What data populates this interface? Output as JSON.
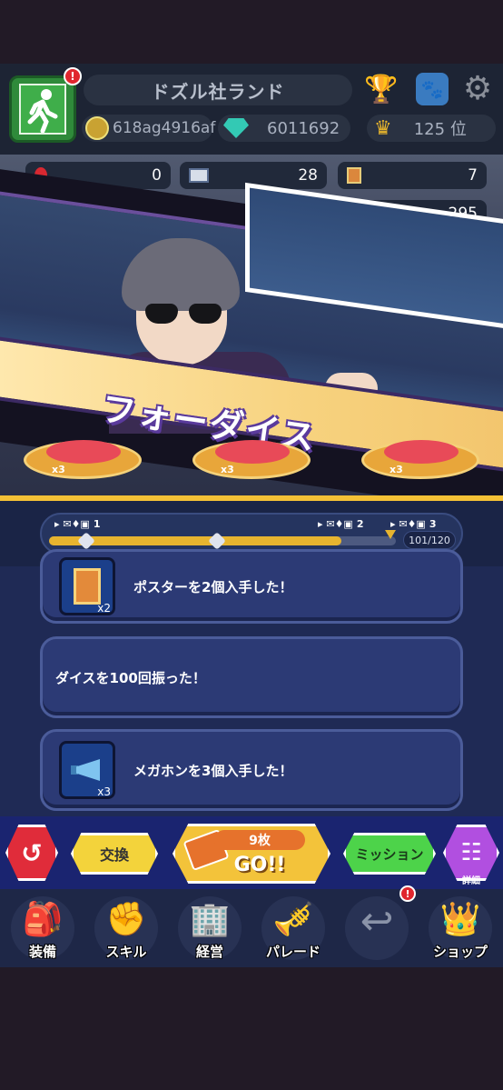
{
  "header": {
    "land_name": "ドズル社ランド",
    "coins": "618ag4916af",
    "gems": "6011692",
    "rank": "125 位",
    "exit_alert": "!"
  },
  "counters": {
    "balloon": "0",
    "ticket": "28",
    "poster": "7",
    "extra": "295"
  },
  "cutscene": {
    "name": "フォーダイス"
  },
  "pads": [
    {
      "label": "x3"
    },
    {
      "label": "x3"
    },
    {
      "label": "x3"
    }
  ],
  "progress": {
    "current": 101,
    "max": 120,
    "count_text": "101/120",
    "milestones": [
      "1",
      "2",
      "3"
    ],
    "ticks": [
      "20",
      "60",
      "80",
      "100"
    ]
  },
  "missions": [
    {
      "text": "ポスターを2個入手した！",
      "qty": "x2",
      "icon": "poster-icon"
    },
    {
      "text": "ダイスを100回振った！",
      "qty": "",
      "icon": ""
    },
    {
      "text": "メガホンを3個入手した！",
      "qty": "x3",
      "icon": "megaphone-icon"
    }
  ],
  "actions": {
    "back": "↺",
    "exchange": "交換",
    "go_count": "9枚",
    "go": "GO!!",
    "mission": "ミッション",
    "detail": "詳細"
  },
  "nav": {
    "equip": "装備",
    "skill": "スキル",
    "manage": "経営",
    "parade": "パレード",
    "shop": "ショップ",
    "shop_alert": "!"
  },
  "colors": {
    "accent_gold": "#e7b42f",
    "go_button": "#f3c33a",
    "mission_button": "#4dd34a",
    "back_button": "#e02c3a",
    "detail_button": "#b14fe0"
  }
}
